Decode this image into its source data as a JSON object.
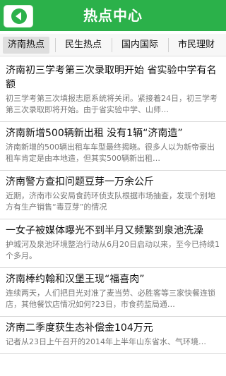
{
  "header": {
    "title": "热点中心"
  },
  "tabs": [
    {
      "label": "济南热点"
    },
    {
      "label": "民生热点"
    },
    {
      "label": "国内国际"
    },
    {
      "label": "市民理财"
    }
  ],
  "news": [
    {
      "title": "济南初三学考第三次录取明开始 省实验中学有名额",
      "desc": "初三学考第三次填报志愿系统将关闭。紧接着24日，初三学考第三次录取即将开始。由于省实验中学、山师…"
    },
    {
      "title": "济南新增500辆新出租 没有1辆“济南造”",
      "desc": "济南新增的500辆出租车车型最终揭晓。很多人以为新帝豪出租车肯定是由本地造，但其实500辆新出租…"
    },
    {
      "title": "济南警方查扣问题豆芽一万余公斤",
      "desc": "近期，济南市公安局食药环侦支队根据市场抽查，发现个别地方有生产销售“毒豆芽”的情况"
    },
    {
      "title": "一女子被媒体曝光不到半月又频繁到泉池洗澡",
      "desc": "护城河及泉池环境整治行动从6月20日启动以来，至今已持续1个多月。"
    },
    {
      "title": "济南棒约翰和汉堡王现“福喜肉”",
      "desc": "连续两天，人们把目光对准了麦当劳、必胜客等三家快餐连锁店，其他餐饮店情况如何?23日，市食药监局通…"
    },
    {
      "title": "济南二季度获生态补偿金104万元",
      "desc": "记者从23日上午召开的2014年上半年山东省水、气环境…"
    }
  ]
}
